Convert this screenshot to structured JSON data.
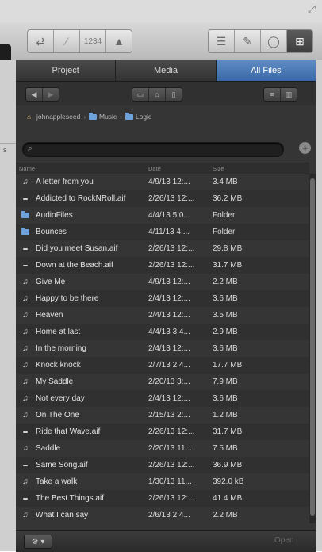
{
  "toolbar": {
    "lcd_label": "1234",
    "icons": [
      "cycle-icon",
      "replace-icon",
      "metronome-icon",
      "list-editors-icon",
      "notepad-icon",
      "loop-browser-icon",
      "media-browser-icon"
    ]
  },
  "browser": {
    "tabs": [
      {
        "label": "Project",
        "selected": false
      },
      {
        "label": "Media",
        "selected": false
      },
      {
        "label": "All Files",
        "selected": true
      }
    ],
    "breadcrumb": {
      "home": "johnappleseed",
      "folder1": "Music",
      "folder2": "Logic"
    },
    "search": {
      "placeholder": "",
      "value": ""
    },
    "columns": {
      "name": "Name",
      "date": "Date",
      "size": "Size"
    },
    "files": [
      {
        "name": "A letter from you",
        "date": "4/9/13 12:...",
        "size": "3.4 MB",
        "kind": "music"
      },
      {
        "name": "Addicted to RockNRoll.aif",
        "date": "2/26/13 12:...",
        "size": "36.2 MB",
        "kind": "audio"
      },
      {
        "name": "AudioFiles",
        "date": "4/4/13 5:0...",
        "size": "Folder",
        "kind": "folder"
      },
      {
        "name": "Bounces",
        "date": "4/11/13 4:...",
        "size": "Folder",
        "kind": "folder"
      },
      {
        "name": "Did you meet Susan.aif",
        "date": "2/26/13 12:...",
        "size": "29.8 MB",
        "kind": "audio"
      },
      {
        "name": "Down at the Beach.aif",
        "date": "2/26/13 12:...",
        "size": "31.7 MB",
        "kind": "audio"
      },
      {
        "name": "Give Me",
        "date": "4/9/13 12:...",
        "size": "2.2 MB",
        "kind": "music"
      },
      {
        "name": "Happy to be there",
        "date": "2/4/13 12:...",
        "size": "3.6 MB",
        "kind": "music"
      },
      {
        "name": "Heaven",
        "date": "2/4/13 12:...",
        "size": "3.5 MB",
        "kind": "music"
      },
      {
        "name": "Home at last",
        "date": "4/4/13 3:4...",
        "size": "2.9 MB",
        "kind": "music"
      },
      {
        "name": "In the morning",
        "date": "2/4/13 12:...",
        "size": "3.6 MB",
        "kind": "music"
      },
      {
        "name": "Knock knock",
        "date": "2/7/13 2:4...",
        "size": "17.7 MB",
        "kind": "music"
      },
      {
        "name": "My Saddle",
        "date": "2/20/13 3:...",
        "size": "7.9 MB",
        "kind": "music"
      },
      {
        "name": "Not every day",
        "date": "2/4/13 12:...",
        "size": "3.6 MB",
        "kind": "music"
      },
      {
        "name": "On The One",
        "date": "2/15/13 2:...",
        "size": "1.2 MB",
        "kind": "music"
      },
      {
        "name": "Ride that Wave.aif",
        "date": "2/26/13 12:...",
        "size": "31.7 MB",
        "kind": "audio"
      },
      {
        "name": "Saddle",
        "date": "2/20/13 11...",
        "size": "7.5 MB",
        "kind": "music"
      },
      {
        "name": "Same Song.aif",
        "date": "2/26/13 12:...",
        "size": "36.9 MB",
        "kind": "audio"
      },
      {
        "name": "Take a walk",
        "date": "1/30/13 11...",
        "size": "392.0 kB",
        "kind": "music"
      },
      {
        "name": "The Best Things.aif",
        "date": "2/26/13 12:...",
        "size": "41.4 MB",
        "kind": "audio"
      },
      {
        "name": "What I can say",
        "date": "2/6/13 2:4...",
        "size": "2.2 MB",
        "kind": "music"
      }
    ],
    "bottom": {
      "gear_label": "⚙ ▾",
      "open_label": "Open"
    }
  },
  "colors": {
    "selected_tab": "#4a78b6",
    "panel_bg": "#353535",
    "folder": "#6fa2da"
  }
}
